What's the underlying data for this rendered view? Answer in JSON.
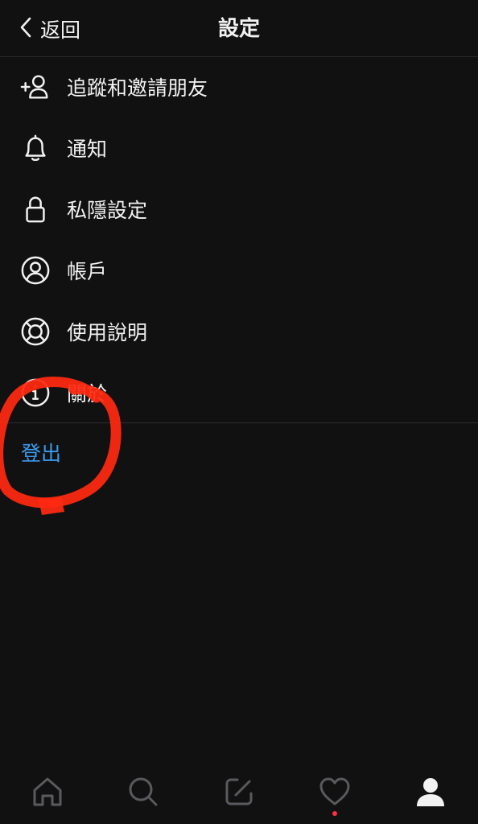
{
  "header": {
    "back_label": "返回",
    "title": "設定"
  },
  "menu": {
    "items": [
      {
        "label": "追蹤和邀請朋友",
        "icon": "add-person-icon"
      },
      {
        "label": "通知",
        "icon": "bell-icon"
      },
      {
        "label": "私隱設定",
        "icon": "lock-icon"
      },
      {
        "label": "帳戶",
        "icon": "account-circle-icon"
      },
      {
        "label": "使用說明",
        "icon": "lifebuoy-icon"
      },
      {
        "label": "關於",
        "icon": "info-icon"
      }
    ]
  },
  "logout": {
    "label": "登出"
  },
  "tabbar": {
    "tabs": [
      {
        "icon": "home-icon",
        "active": false
      },
      {
        "icon": "search-icon",
        "active": false
      },
      {
        "icon": "new-post-icon",
        "active": false
      },
      {
        "icon": "heart-icon",
        "active": false,
        "notification": true
      },
      {
        "icon": "profile-icon",
        "active": true
      }
    ]
  },
  "colors": {
    "background": "#111112",
    "text": "#f2f2f2",
    "accent": "#3b9df0",
    "annotation": "#ff2a10",
    "notification_dot": "#ff3040"
  }
}
